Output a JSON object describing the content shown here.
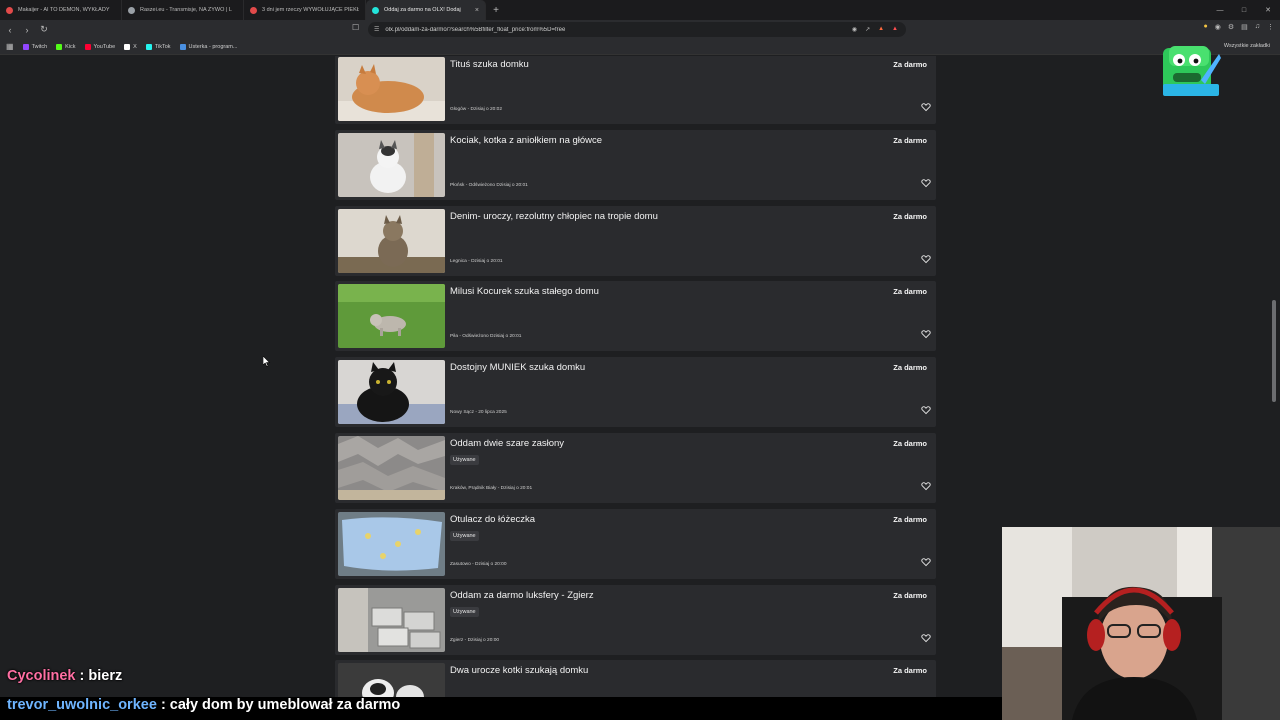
{
  "browser": {
    "tabs": [
      {
        "title": "Makaijer - AI TO DEMON, WYKŁADY",
        "color": "#e24a4a",
        "active": false
      },
      {
        "title": "Raszei.eu - Transmisje, NA ŻYWO | L",
        "color": "#9aa0a6",
        "active": false
      },
      {
        "title": "3 dni jem rzeczy WYWOŁUJĄCE PIEKŁ",
        "color": "#e24a4a",
        "active": false
      },
      {
        "title": "Oddaj za darmo na OLX! Dodaj",
        "color": "#23e5db",
        "active": true
      }
    ],
    "tab_close": "×",
    "new_tab": "+",
    "url": "olx.pl/oddam-za-darmo/?search%5Bfilter_float_price:from%5D=free",
    "bookmarks": [
      {
        "label": "Twitch",
        "color": "#9146ff"
      },
      {
        "label": "Kick",
        "color": "#53fc18"
      },
      {
        "label": "YouTube",
        "color": "#ff0033"
      },
      {
        "label": "X",
        "color": "#ffffff"
      },
      {
        "label": "TikTok",
        "color": "#25f4ee"
      },
      {
        "label": "Usterka - program...",
        "color": "#4a90e2"
      }
    ],
    "all_bookmarks": "Wszystkie zakładki"
  },
  "listings": [
    {
      "title": "Tituś szuka domku",
      "price": "Za darmo",
      "condition": "",
      "location": "Głogów - Dzisiaj o 20:02",
      "thumb": "cat-ginger"
    },
    {
      "title": "Kociak, kotka z aniołkiem na główce",
      "price": "Za darmo",
      "condition": "",
      "location": "Płońsk - Odświeżono Dzisiaj o 20:01",
      "thumb": "cat-white"
    },
    {
      "title": "Denim- uroczy, rezolutny chłopiec na tropie domu",
      "price": "Za darmo",
      "condition": "",
      "location": "Legnica - Dzisiaj o 20:01",
      "thumb": "cat-tabby"
    },
    {
      "title": "Milusi Kocurek szuka stałego domu",
      "price": "Za darmo",
      "condition": "",
      "location": "Piła - Odświeżono Dzisiaj o 20:01",
      "thumb": "cat-grass"
    },
    {
      "title": "Dostojny MUNIEK szuka domku",
      "price": "Za darmo",
      "condition": "",
      "location": "Nowy Sącz - 20 lipca 2025",
      "thumb": "cat-black"
    },
    {
      "title": "Oddam dwie szare zasłony",
      "price": "Za darmo",
      "condition": "Używane",
      "location": "Kraków, Prądnik Biały - Dzisiaj o 20:01",
      "thumb": "curtains"
    },
    {
      "title": "Otulacz do łóżeczka",
      "price": "Za darmo",
      "condition": "Używane",
      "location": "Zasutowo - Dzisiaj o 20:00",
      "thumb": "bedding"
    },
    {
      "title": "Oddam za darmo luksfery - Zgierz",
      "price": "Za darmo",
      "condition": "Używane",
      "location": "Zgierz - Dzisiaj o 20:00",
      "thumb": "glassblocks"
    },
    {
      "title": "Dwa urocze kotki szukają domku",
      "price": "Za darmo",
      "condition": "",
      "location": "",
      "thumb": "kittens"
    }
  ],
  "chat": [
    {
      "user": "Cycolinek",
      "message": ": bierz"
    },
    {
      "user": "trevor_uwolnic_orkee",
      "message": ": cały dom by umeblował za darmo"
    }
  ],
  "colors": {
    "page_bg": "#1e1f21",
    "card_bg": "#2a2b2e",
    "chat_user1": "#ff6fa3",
    "chat_user2": "#6fb5ff"
  }
}
